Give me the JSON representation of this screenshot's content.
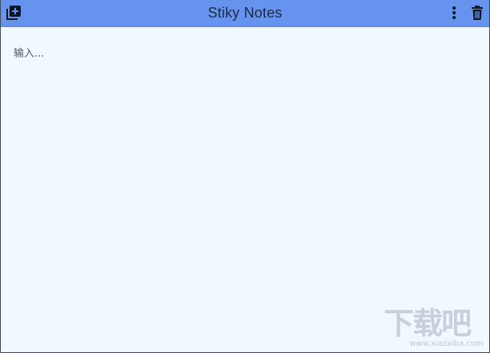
{
  "window": {
    "title": "Stiky Notes"
  },
  "toolbar": {
    "add_icon": "add-note-icon",
    "menu_icon": "more-vert-icon",
    "delete_icon": "trash-icon"
  },
  "note": {
    "placeholder": "输入...",
    "value": ""
  },
  "watermark": {
    "logo_text": "下载吧",
    "url": "www.xiazaiba.com"
  },
  "colors": {
    "titlebar": "#6593ee",
    "body": "#f1f8ff",
    "icon": "#0d1422"
  }
}
